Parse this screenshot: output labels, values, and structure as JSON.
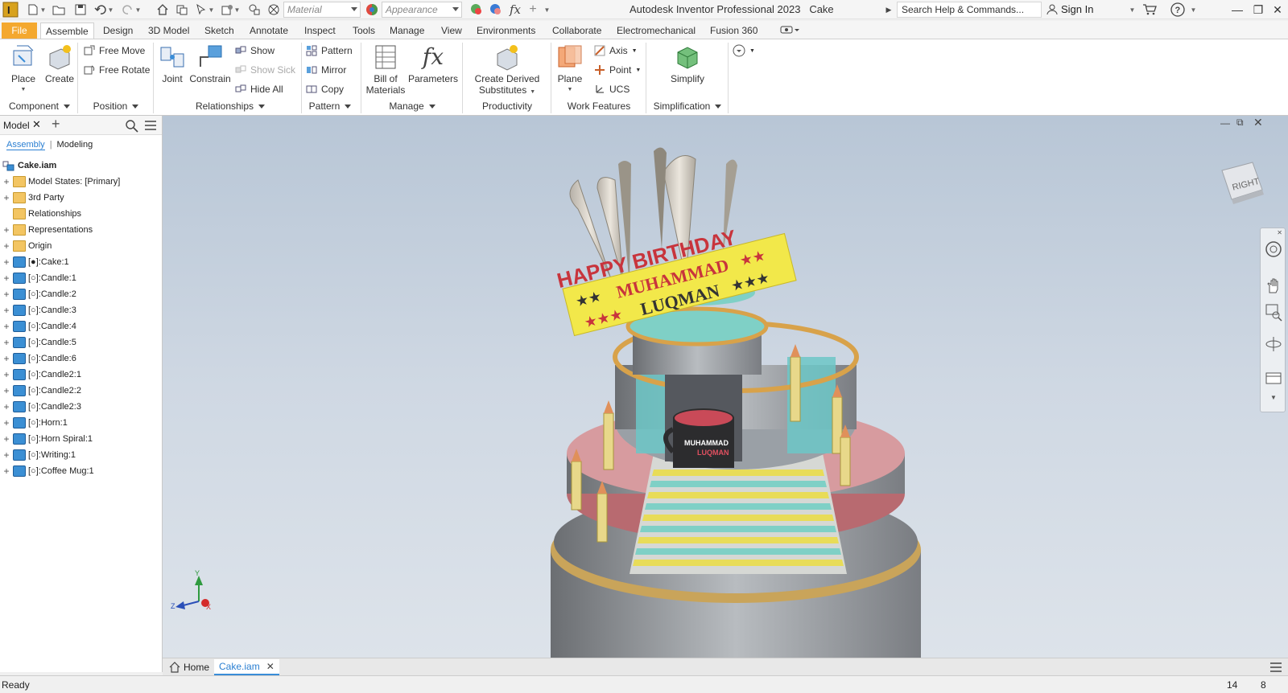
{
  "titlebar": {
    "app_title": "Autodesk Inventor Professional 2023",
    "doc_name": "Cake",
    "material_placeholder": "Material",
    "appearance_placeholder": "Appearance",
    "search_placeholder": "Search Help & Commands...",
    "sign_in": "Sign In"
  },
  "tabs": [
    "File",
    "Assemble",
    "Design",
    "3D Model",
    "Sketch",
    "Annotate",
    "Inspect",
    "Tools",
    "Manage",
    "View",
    "Environments",
    "Collaborate",
    "Electromechanical",
    "Fusion 360"
  ],
  "ribbon": {
    "component": {
      "place": "Place",
      "create": "Create",
      "label": "Component"
    },
    "position": {
      "free_move": "Free Move",
      "free_rotate": "Free Rotate",
      "label": "Position"
    },
    "relationships": {
      "joint": "Joint",
      "constrain": "Constrain",
      "show": "Show",
      "show_sick": "Show Sick",
      "hide_all": "Hide All",
      "label": "Relationships"
    },
    "pattern": {
      "pattern": "Pattern",
      "mirror": "Mirror",
      "copy": "Copy",
      "label": "Pattern"
    },
    "manage": {
      "bom_line1": "Bill of",
      "bom_line2": "Materials",
      "parameters": "Parameters",
      "label": "Manage"
    },
    "productivity": {
      "line1": "Create Derived",
      "line2": "Substitutes",
      "label": "Productivity"
    },
    "work_features": {
      "plane": "Plane",
      "axis": "Axis",
      "point": "Point",
      "ucs": "UCS",
      "label": "Work Features"
    },
    "simplification": {
      "simplify": "Simplify",
      "label": "Simplification"
    }
  },
  "browser": {
    "tab_title": "Model",
    "subtab_assembly": "Assembly",
    "subtab_modeling": "Modeling",
    "root": "Cake.iam",
    "nodes": [
      {
        "label": "Model States: [Primary]",
        "icon": "folder"
      },
      {
        "label": "3rd Party",
        "icon": "thirdparty"
      },
      {
        "label": "Relationships",
        "icon": "folder"
      },
      {
        "label": "Representations",
        "icon": "folder"
      },
      {
        "label": "Origin",
        "icon": "folder"
      },
      {
        "label": "[●]:Cake:1",
        "icon": "part-active"
      },
      {
        "label": "[○]:Candle:1",
        "icon": "part"
      },
      {
        "label": "[○]:Candle:2",
        "icon": "part"
      },
      {
        "label": "[○]:Candle:3",
        "icon": "part"
      },
      {
        "label": "[○]:Candle:4",
        "icon": "part"
      },
      {
        "label": "[○]:Candle:5",
        "icon": "part"
      },
      {
        "label": "[○]:Candle:6",
        "icon": "part"
      },
      {
        "label": "[○]:Candle2:1",
        "icon": "part"
      },
      {
        "label": "[○]:Candle2:2",
        "icon": "part"
      },
      {
        "label": "[○]:Candle2:3",
        "icon": "part"
      },
      {
        "label": "[○]:Horn:1",
        "icon": "part"
      },
      {
        "label": "[○]:Horn Spiral:1",
        "icon": "part"
      },
      {
        "label": "[○]:Writing:1",
        "icon": "part"
      },
      {
        "label": "[○]:Coffee Mug:1",
        "icon": "part"
      }
    ]
  },
  "viewport": {
    "banner_line1": "HAPPY BIRTHDAY",
    "banner_line2": "MUHAMMAD",
    "banner_line3": "LUQMAN",
    "mug_text1": "MUHAMMAD",
    "mug_text2": "LUQMAN",
    "viewcube_face": "RIGHT",
    "triad_x": "X",
    "triad_y": "Y",
    "triad_z": "Z"
  },
  "doc_tabs": {
    "home": "Home",
    "active": "Cake.iam"
  },
  "status": {
    "text": "Ready",
    "count1": "14",
    "count2": "8"
  },
  "colors": {
    "file_tab": "#f4a82f",
    "accent": "#2a7fd2",
    "banner": "#f2e84a",
    "banner_text": "#c8343c"
  }
}
